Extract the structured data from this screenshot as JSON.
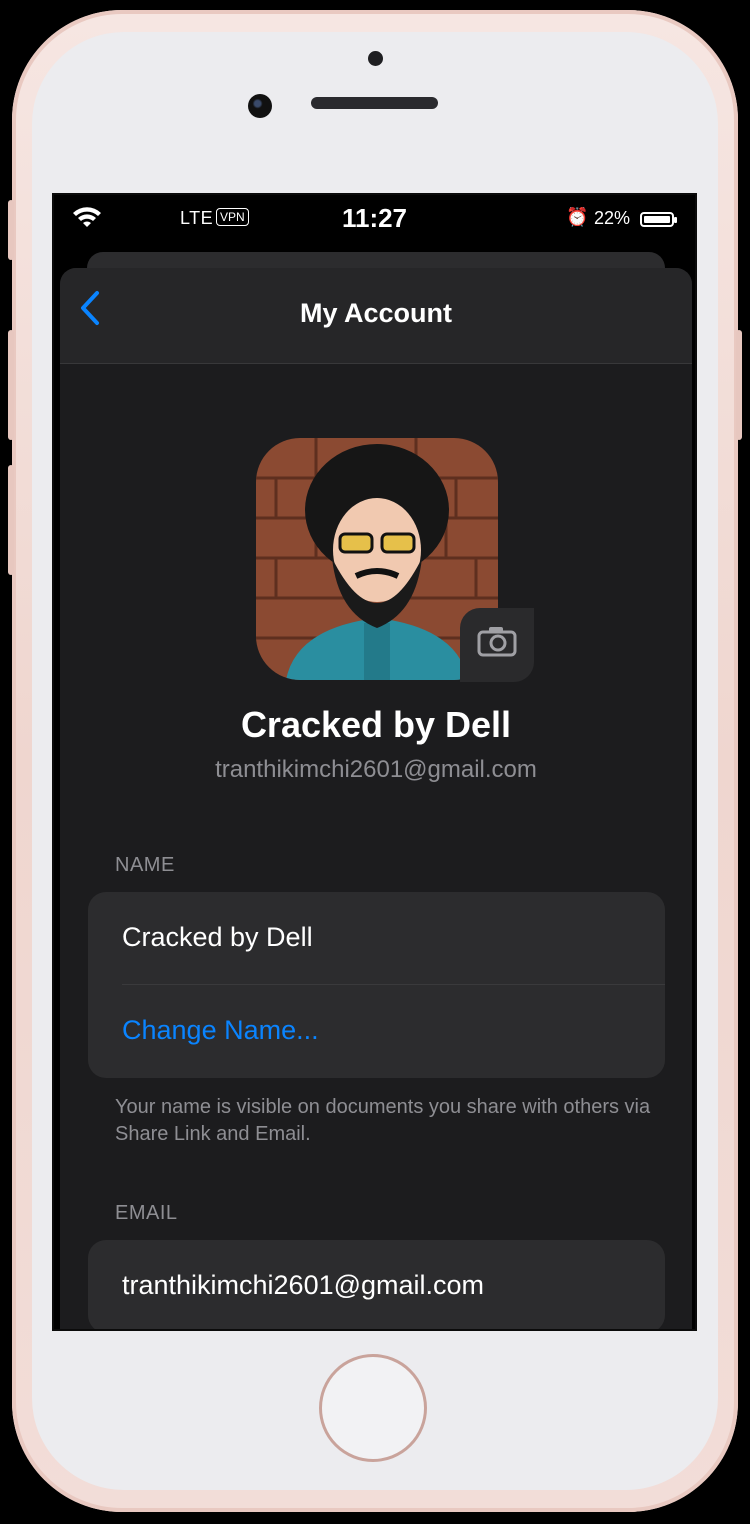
{
  "status_bar": {
    "carrier": "LTE",
    "vpn": "VPN",
    "time": "11:27",
    "battery_percent": "22%"
  },
  "nav": {
    "title": "My Account",
    "back_icon": "chevron-left-icon"
  },
  "profile": {
    "name": "Cracked by Dell",
    "email": "tranthikimchi2601@gmail.com",
    "camera_icon": "camera-icon"
  },
  "name_section": {
    "header": "NAME",
    "value": "Cracked by Dell",
    "action": "Change Name...",
    "footer": "Your name is visible on documents you share with others via Share Link and Email."
  },
  "email_section": {
    "header": "EMAIL",
    "value": "tranthikimchi2601@gmail.com"
  },
  "colors": {
    "accent": "#0a84ff",
    "background": "#1c1c1e",
    "card": "#2c2c2e"
  }
}
